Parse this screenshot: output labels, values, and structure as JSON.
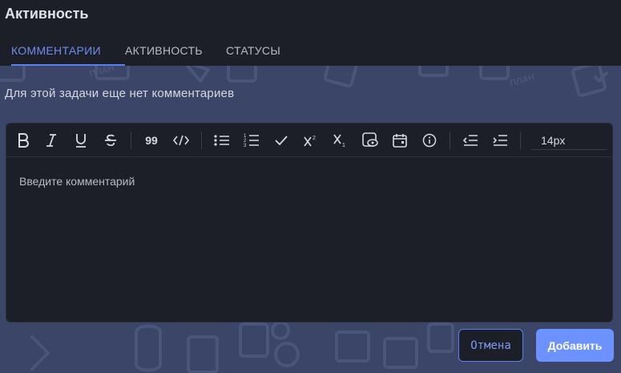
{
  "panel": {
    "title": "Активность"
  },
  "tabs": [
    {
      "label": "КОММЕНТАРИИ",
      "active": true
    },
    {
      "label": "АКТИВНОСТЬ",
      "active": false
    },
    {
      "label": "СТАТУСЫ",
      "active": false
    }
  ],
  "activity": {
    "empty_message": "Для этой задачи еще нет комментариев"
  },
  "editor": {
    "toolbar": {
      "bold_icon": "bold-icon",
      "quote_label": "99",
      "font_size": "14px"
    },
    "placeholder": "Введите комментарий"
  },
  "actions": {
    "cancel_label": "Отмена",
    "add_label": "Добавить"
  },
  "colors": {
    "background": "#1c1f27",
    "pattern_area": "#3a4567",
    "accent": "#5b7ff0",
    "primary_button": "#6c92ff"
  }
}
